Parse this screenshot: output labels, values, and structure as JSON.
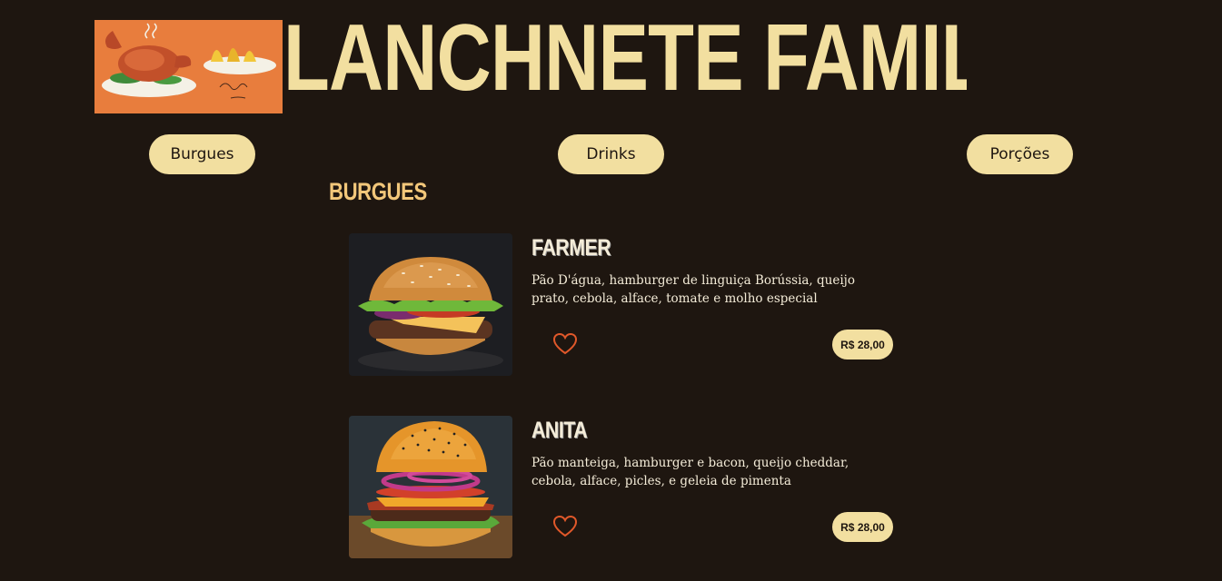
{
  "header": {
    "title": "LANCHNETE FAMILIA PAVÃO",
    "logo_icon": "roast-chicken-painting"
  },
  "nav": {
    "burgues": "Burgues",
    "drinks": "Drinks",
    "porcoes": "Porções"
  },
  "section": {
    "title": "BURGUES"
  },
  "items": [
    {
      "name": "FARMER",
      "description": "Pão D'água, hamburger de linguiça Borússia, queijo prato, cebola, alface, tomate e molho especial",
      "price": "R$ 28,00",
      "image_icon": "burger-photo"
    },
    {
      "name": "ANITA",
      "description": "Pão manteiga, hamburger e bacon, queijo cheddar, cebola, alface, picles, e geleia de pimenta",
      "price": "R$ 28,00",
      "image_icon": "burger-photo"
    }
  ],
  "colors": {
    "background": "#1e1610",
    "accent": "#f2dfa0",
    "heart": "#e0582a"
  }
}
